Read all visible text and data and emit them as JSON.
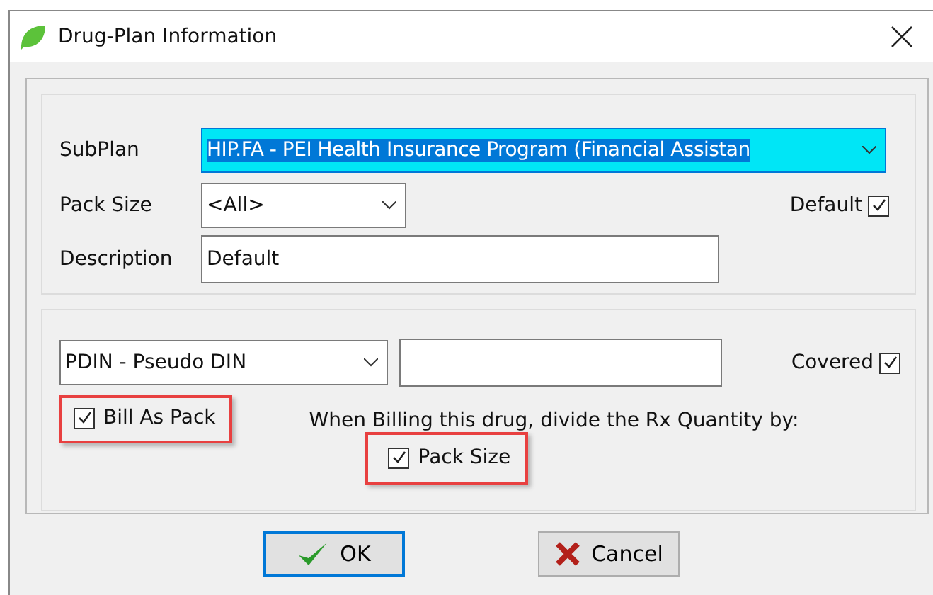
{
  "window": {
    "title": "Drug-Plan Information"
  },
  "plan": {
    "subplan_label": "SubPlan",
    "subplan_value": "HIP.FA - PEI Health Insurance Program (Financial Assistan",
    "subplan_selected": true,
    "pack_size_label": "Pack Size",
    "pack_size_value": "<All>",
    "default": {
      "label": "Default",
      "checked": true
    },
    "description_label": "Description",
    "description_value": "Default"
  },
  "coverage": {
    "code_value": "PDIN - Pseudo DIN",
    "covered": {
      "label": "Covered",
      "checked": true
    },
    "bill_as_pack": {
      "label": "Bill As Pack",
      "checked": true,
      "highlighted": true
    },
    "divide_text": "When Billing this drug, divide the Rx Quantity by:",
    "pack_size": {
      "label": "Pack Size",
      "checked": true,
      "highlighted": true
    }
  },
  "buttons": [
    {
      "label": "OK",
      "kind": "ok",
      "default": true
    },
    {
      "label": "Cancel",
      "kind": "cancel",
      "default": false
    }
  ]
}
